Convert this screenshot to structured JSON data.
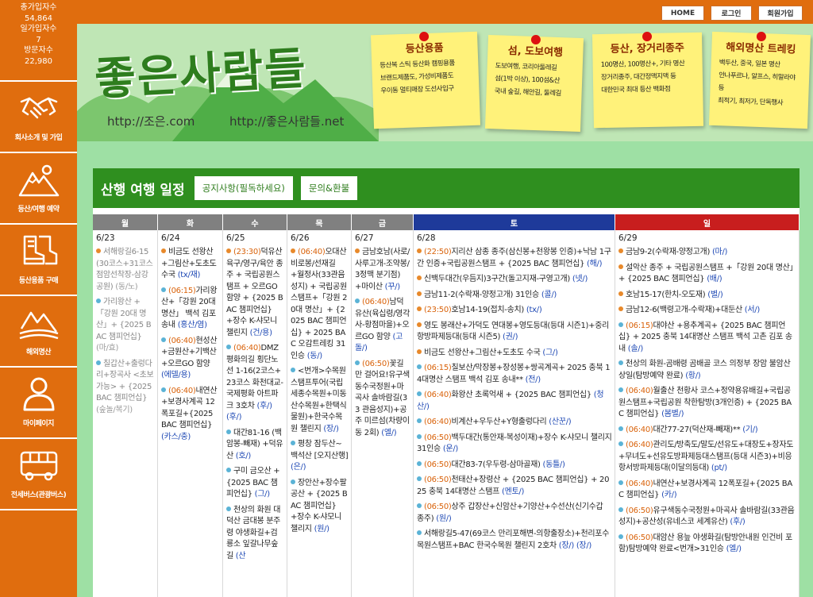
{
  "sidebar": {
    "stats": [
      {
        "label": "총가입자수",
        "value": "54,864"
      },
      {
        "label": "일가입자수",
        "value": "7"
      },
      {
        "label": "방문자수",
        "value": "22,980"
      }
    ],
    "menu": [
      {
        "label": "회사소개 및 가입",
        "icon": "handshake-icon"
      },
      {
        "label": "등산/여행 예약",
        "icon": "mountain-icon"
      },
      {
        "label": "등산용품 구매",
        "icon": "boots-icon"
      },
      {
        "label": "해외명산",
        "icon": "globe-mountain-icon"
      },
      {
        "label": "마이페이지",
        "icon": "user-icon"
      },
      {
        "label": "전세버스(관광버스)",
        "icon": "bus-icon"
      }
    ]
  },
  "topbar": {
    "home": "HOME",
    "login": "로그인",
    "join": "회원가입"
  },
  "banner": {
    "logo": "좋은사람들",
    "url1": "http://조은.com",
    "url2": "http://좋은사람들.net",
    "notes": [
      {
        "title": "등산용품",
        "lines": [
          "등산복 스틱 등산화 캠핑용품",
          "브랜드제품도, 가성비제품도",
          "우이동 멀티매장 도선사입구"
        ]
      },
      {
        "title": "섬, 도보여행",
        "lines": [
          "도보여행, 코리아둘레길",
          "섬(1박 이상), 100섬&산",
          "국내 숲길, 해안길, 둘레길"
        ]
      },
      {
        "title": "등산, 장거리종주",
        "lines": [
          "100명산, 100명산+, 기타 명산",
          "장거리종주, 대간정맥지맥 등",
          "대한민국 최대 등산 백화점"
        ]
      },
      {
        "title": "해외명산 트레킹",
        "lines": [
          "백두산, 중국, 일본 명산",
          "안나푸르나, 알프스, 히말라야 등",
          "최적기, 최저가, 단독행사"
        ]
      }
    ]
  },
  "panel": {
    "title": "산행 여행 일정",
    "notice_btn": "공지사항(필독하세요)",
    "inquiry_btn": "문의&환불",
    "days": [
      "월",
      "화",
      "수",
      "목",
      "금",
      "토",
      "일"
    ],
    "colors": {
      "weekday": "#808080",
      "saturday": "#1e3a9a",
      "sunday": "#c81e1e",
      "orange": "#e8892b",
      "blue": "#5bb3d6"
    },
    "columns": [
      {
        "date": "6/23",
        "events": [
          {
            "dot": "orange",
            "time": "",
            "text": "서해랑길6-15(30코스+31코스 점암선착장-삼강공원)",
            "status": "(동/노)",
            "past": true
          },
          {
            "dot": "blue",
            "time": "",
            "text": "가리왕산 +「강원 20대 명산」+ {2025 BAC 챔피언십}",
            "status": "(마/효)",
            "past": true
          },
          {
            "dot": "blue",
            "time": "",
            "text": "칠갑산+출렁다리+장곡사 <초보가능> + {2025 BAC 챔피언십}",
            "status": "(숲놀/복기)",
            "past": true
          }
        ]
      },
      {
        "date": "6/24",
        "events": [
          {
            "dot": "orange",
            "time": "",
            "text": "비금도 선왕산+그림산+도초도 수국",
            "status": "(tx/재)",
            "past": false
          },
          {
            "dot": "blue",
            "time": "(06:15)",
            "text": "가리왕산+「강원 20대 명산」 백석 김포 송내",
            "status": "(홍산/염)",
            "past": false
          },
          {
            "dot": "blue",
            "time": "(06:40)",
            "text": "현성산+금원산+기백산+오르GO 함양",
            "status": "(에델/용)",
            "past": false
          },
          {
            "dot": "blue",
            "time": "(06:40)",
            "text": "내연산+보경사계곡 12폭포길+{2025 BAC 챔피언십}",
            "status": "(카스/충)",
            "past": false
          }
        ]
      },
      {
        "date": "6/25",
        "events": [
          {
            "dot": "orange",
            "time": "(23:30)",
            "text": "덕유산 육구/영구/육안 종주 + 국립공원스탬프 + 오르GO 함양 + {2025 BAC 챔피언십} +장수 K-샤모니 챌린지",
            "status": "(건/용)",
            "past": false
          },
          {
            "dot": "blue",
            "time": "(06:40)",
            "text": "DMZ 평화의길 횡단노선 1-16(2코스+23코스 화천대교-국제평화 아트파크 3호차",
            "status": "(후/) (후/)",
            "past": false
          },
          {
            "dot": "blue",
            "time": "",
            "text": "대간81-16 (백암봉-빼재) +덕유산",
            "status": "(호/)",
            "past": false
          },
          {
            "dot": "blue",
            "time": "",
            "text": "구미 금오산 + {2025 BAC 챔피언십}",
            "status": "(그/)",
            "past": false
          },
          {
            "dot": "blue",
            "time": "",
            "text": "천상의 화원 대덕산 금대봉 분주령 야생화길+검룡소 잎갈나무숲길",
            "status": "(산",
            "past": false
          }
        ]
      },
      {
        "date": "6/26",
        "events": [
          {
            "dot": "orange",
            "time": "(06:40)",
            "text": "오대산 비로봉/선재길+월정사(33관음성지) + 국립공원스탬프+「강원 20대 명산」+ {2025 BAC 챔피언십} + 2025 BAC 오감트레킹 31인승",
            "status": "(동/)",
            "past": false
          },
          {
            "dot": "blue",
            "time": "",
            "text": "<번개>수목원 스탬프투어(국립세종수목원+미동산수목원+한택식물원)+한국수목원 챌린지",
            "status": "(장/)",
            "past": false
          },
          {
            "dot": "blue",
            "time": "",
            "text": "평창 잠두산~백석산 [오지산행]",
            "status": "(은/)",
            "past": false
          },
          {
            "dot": "blue",
            "time": "",
            "text": "장안산+장수팔공산 + {2025 BAC 챔피언십}+장수 K-샤모니 챌리지",
            "status": "(원/)",
            "past": false
          }
        ]
      },
      {
        "date": "6/27",
        "events": [
          {
            "dot": "orange",
            "time": "",
            "text": "금남호남(사로/사루고개-조약봉/3정맥 분기점)+마이산",
            "status": "(꾸/)",
            "past": false
          },
          {
            "dot": "blue",
            "time": "(06:40)",
            "text": "남덕유산(육십령/영각사-황점마을)+오르GO 함양",
            "status": "(고돌/)",
            "past": false
          },
          {
            "dot": "blue",
            "time": "(06:50)",
            "text": "꽃길만 걸어요!유구색동수국정원+마곡사 솔바람길(33 관음성지)+공주 미르섬(차량이동 2회)",
            "status": "(엘/)",
            "past": false
          }
        ]
      },
      {
        "date": "6/28",
        "events": [
          {
            "dot": "orange",
            "time": "(22:50)",
            "text": "지리산 삼종 종주(삼신봉+천왕봉 인증)+낙남 1구간 인증+국립공원스탬프 + {2025 BAC 챔피언십}",
            "status": "(해/)",
            "past": false
          },
          {
            "dot": "orange",
            "time": "",
            "text": "신백두대간(우듬지)3구간(돌고지재-구영고개)",
            "status": "(넷/)",
            "past": false
          },
          {
            "dot": "orange",
            "time": "",
            "text": "금남11-2(수락재-양정고개) 31인승",
            "status": "(콜/)",
            "past": false
          },
          {
            "dot": "orange",
            "time": "(23:50)",
            "text": "호남14-19(접치-송치)",
            "status": "(tx/)",
            "past": false
          },
          {
            "dot": "orange",
            "time": "",
            "text": "영도 봉래산+가덕도 연대봉+영도등대(등대 시즌1)+중리항방파제등대(등대 시즌5)",
            "status": "(권/)",
            "past": false
          },
          {
            "dot": "orange",
            "time": "",
            "text": "비금도 선왕산+그림산+도초도 수국",
            "status": "(그/)",
            "past": false
          },
          {
            "dot": "blue",
            "time": "(06:15)",
            "text": "칠보산/막장봉+장성봉+쌍곡계곡+ 2025 충북 14대명산 스탬프 백석 김포 송내**",
            "status": "(전/)",
            "past": false
          },
          {
            "dot": "blue",
            "time": "(06:40)",
            "text": "화왕산 초록억새 + {2025 BAC 챔피언십}",
            "status": "(청산/)",
            "past": false
          },
          {
            "dot": "blue",
            "time": "(06:40)",
            "text": "비계산+우두산+Y형출렁다리",
            "status": "(산꾼/)",
            "past": false
          },
          {
            "dot": "blue",
            "time": "(06:50)",
            "text": "백두대간(통안재-복성이재)+장수 K-샤모니 챌리지 31인승",
            "status": "(운/)",
            "past": false
          },
          {
            "dot": "blue",
            "time": "(06:50)",
            "text": "대간83-7(우두령-삼마골재)",
            "status": "(동틀/)",
            "past": false
          },
          {
            "dot": "blue",
            "time": "(06:50)",
            "text": "천태산+장령산 + {2025 BAC 챔피언십} + 2025 충북 14대명산 스탬프",
            "status": "(멘토/)",
            "past": false
          },
          {
            "dot": "blue",
            "time": "(06:50)",
            "text": "상주 갑장산+신암산+기양산+수선산(신기수갑 종주)",
            "status": "(원/)",
            "past": false
          },
          {
            "dot": "blue",
            "time": "",
            "text": "서해랑길5-47(69코스 만리포해변-의항출장소)+천리포수목원스탬프+BAC 한국수목원 챌린지 2호차",
            "status": "(장/) (장/)",
            "past": false
          }
        ]
      },
      {
        "date": "6/29",
        "events": [
          {
            "dot": "orange",
            "time": "",
            "text": "금남9-2(수락재-양정고개)",
            "status": "(마/)",
            "past": false
          },
          {
            "dot": "orange",
            "time": "",
            "text": "설악산 종주 + 국립공원스탬프 +「강원 20대 명산」+ {2025 BAC 챔피언십}",
            "status": "(배/)",
            "past": false
          },
          {
            "dot": "orange",
            "time": "",
            "text": "호남15-17(한치-오도재)",
            "status": "(별/)",
            "past": false
          },
          {
            "dot": "orange",
            "time": "",
            "text": "금남12-6(백령고개-수락재)+대둔산",
            "status": "(서/)",
            "past": false
          },
          {
            "dot": "blue",
            "time": "(06:15)",
            "text": "대야산 +용추계곡+ {2025 BAC 챔피언십} + 2025 충북 14대명산 스탬프 백석 고촌 김포 송내",
            "status": "(솔/)",
            "past": false
          },
          {
            "dot": "blue",
            "time": "",
            "text": "천상의 화원-곰배령 곰배골 코스 의정부 장암 불암산 상일(탐방예약 완료)",
            "status": "(황/)",
            "past": false
          },
          {
            "dot": "blue",
            "time": "(06:40)",
            "text": "월출산 천황사 코스+정약용유배길+국립공원스탬프+국립공원 착한탐방(3개인증) + {2025 BAC 챔피언십}",
            "status": "(봄별/)",
            "past": false
          },
          {
            "dot": "blue",
            "time": "(06:40)",
            "text": "대간77-27(덕산재-빼재)**",
            "status": "(기/)",
            "past": false
          },
          {
            "dot": "blue",
            "time": "(06:40)",
            "text": "관리도/방축도/말도/선유도+대장도+장자도+무녀도+선유도방파제등대스탬프(등대 시즌3)+비응항서방파제등대(이달의등대)",
            "status": "(pt/)",
            "past": false
          },
          {
            "dot": "blue",
            "time": "(06:40)",
            "text": "내연산+보경사계곡 12폭포길+{2025 BAC 챔피언십}",
            "status": "(카/)",
            "past": false
          },
          {
            "dot": "blue",
            "time": "(06:50)",
            "text": "유구색동수국정원+마곡사 솔바람길(33관음성지)+공산성(유네스코 세계유산)",
            "status": "(후/)",
            "past": false
          },
          {
            "dot": "blue",
            "time": "(06:50)",
            "text": "대암산 용늪 야생화길(탐방안내원 인건비 포함)탐방예약 완료<번개>31인승",
            "status": "(엘/)",
            "past": false
          }
        ]
      }
    ]
  }
}
